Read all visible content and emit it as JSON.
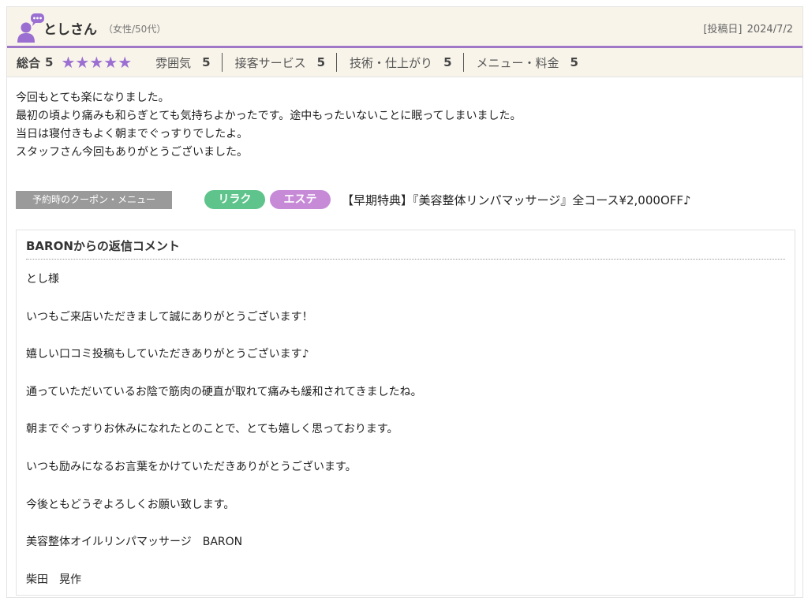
{
  "reviewer": {
    "name": "としさん",
    "meta": "（女性/50代）",
    "post_date_label": "[投稿日]",
    "post_date": "2024/7/2"
  },
  "ratings": {
    "overall_label": "総合",
    "overall_score": "5",
    "stars": 5,
    "items": [
      {
        "label": "雰囲気",
        "score": "5"
      },
      {
        "label": "接客サービス",
        "score": "5"
      },
      {
        "label": "技術・仕上がり",
        "score": "5"
      },
      {
        "label": "メニュー・料金",
        "score": "5"
      }
    ]
  },
  "review_lines": [
    "今回もとても楽になりました。",
    "最初の頃より痛みも和らぎとても気持ちよかったです。途中もったいないことに眠ってしまいました。",
    "当日は寝付きもよく朝までぐっすりでしたよ。",
    "スタッフさん今回もありがとうございました。"
  ],
  "coupon": {
    "label": "予約時のクーポン・メニュー",
    "tags": [
      "リラク",
      "エステ"
    ],
    "text": "【早期特典】『美容整体リンパマッサージ』全コース¥2,000OFF♪"
  },
  "reply": {
    "title": "BARONからの返信コメント",
    "lines": [
      "とし様",
      "いつもご来店いただきまして誠にありがとうございます！",
      "嬉しい口コミ投稿もしていただきありがとうございます♪",
      "通っていただいているお陰で筋肉の硬直が取れて痛みも緩和されてきましたね。",
      "朝までぐっすりお休みになれたとのことで、とても嬉しく思っております。",
      "いつも励みになるお言葉をかけていただきありがとうございます。",
      "今後ともどうぞよろしくお願い致します。",
      "美容整体オイルリンパマッサージ　BARON",
      "柴田　晃作"
    ]
  },
  "colors": {
    "accent": "#a078c8",
    "star": "#9b6fd1",
    "tag_relax": "#5ec48b",
    "tag_esthe": "#c78ad7",
    "coupon_label_bg": "#9a9a9a",
    "header_bg": "#f8f4ea"
  },
  "icons": {
    "avatar": "user-comment-icon",
    "star": "star-icon"
  }
}
